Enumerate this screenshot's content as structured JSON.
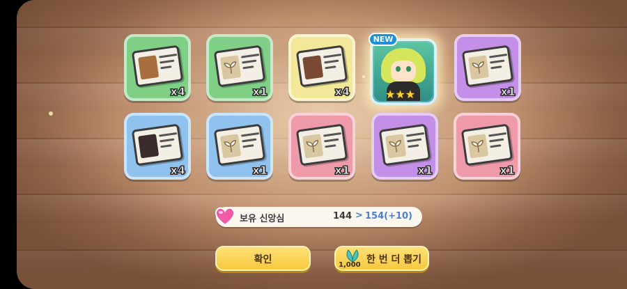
{
  "rewards": [
    {
      "quantity": "x4",
      "icon": "wooden-golem-card-icon",
      "color": "#7fcf86"
    },
    {
      "quantity": "x1",
      "icon": "sprout-card-icon",
      "color": "#7fcf86"
    },
    {
      "quantity": "x4",
      "icon": "brown-hair-character-card-icon",
      "color": "#f3e79a"
    },
    {
      "quantity": "",
      "icon": "green-hair-character-icon",
      "badge": "NEW",
      "stars": "★★★",
      "color": "#4aa3c9"
    },
    {
      "quantity": "x1",
      "icon": "sprout-card-icon",
      "color": "#c48fe6"
    },
    {
      "quantity": "x4",
      "icon": "dark-hair-character-card-icon",
      "color": "#8fc3ee"
    },
    {
      "quantity": "x1",
      "icon": "sprout-card-icon",
      "color": "#8fc3ee"
    },
    {
      "quantity": "x1",
      "icon": "sprout-card-icon",
      "color": "#ef9aa8"
    },
    {
      "quantity": "x1",
      "icon": "sprout-card-icon",
      "color": "#c48fe6"
    },
    {
      "quantity": "x1",
      "icon": "sprout-card-icon",
      "color": "#ef9aa8"
    }
  ],
  "faith": {
    "label": "보유 신앙심",
    "current": "144",
    "arrow": ">",
    "new_value": "154(+10)",
    "icon": "pink-heart-icon"
  },
  "buttons": {
    "confirm": "확인",
    "draw_again": "한 번 더 뽑기",
    "draw_cost": "1,000",
    "draw_icon": "leaf-currency-icon"
  },
  "colors": {
    "button": "#f6c73a",
    "accent_blue": "#4a7fd0",
    "board": "#a97758"
  }
}
